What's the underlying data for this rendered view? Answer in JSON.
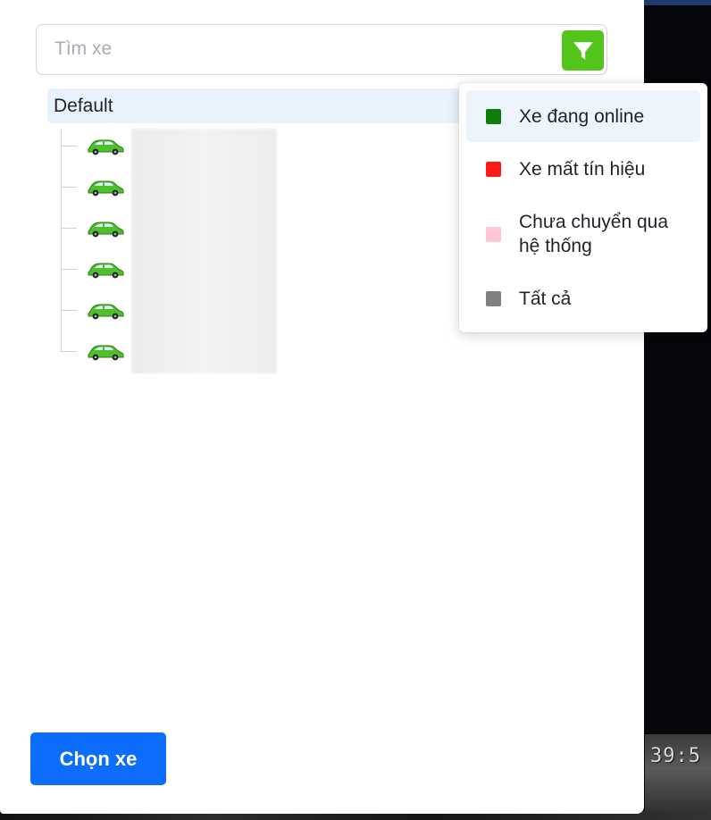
{
  "search": {
    "placeholder": "Tìm xe",
    "value": ""
  },
  "filter": {
    "icon": "funnel-icon",
    "accent": "#52c41a"
  },
  "tree": {
    "root_label": "Default",
    "vehicle_icon": "green-car-icon",
    "vehicle_count": 6
  },
  "filter_menu": {
    "items": [
      {
        "label": "Xe đang online",
        "color": "#0a7d0a",
        "selected": true
      },
      {
        "label": "Xe mất tín hiệu",
        "color": "#ff1a1a",
        "selected": false
      },
      {
        "label": "Chưa chuyển qua hệ thống",
        "color": "#ffc6d3",
        "selected": false
      },
      {
        "label": "Tất cả",
        "color": "#808080",
        "selected": false
      }
    ]
  },
  "footer": {
    "choose_label": "Chọn xe",
    "choose_color": "#0d6efd"
  },
  "background": {
    "clock_text": "39:5"
  }
}
